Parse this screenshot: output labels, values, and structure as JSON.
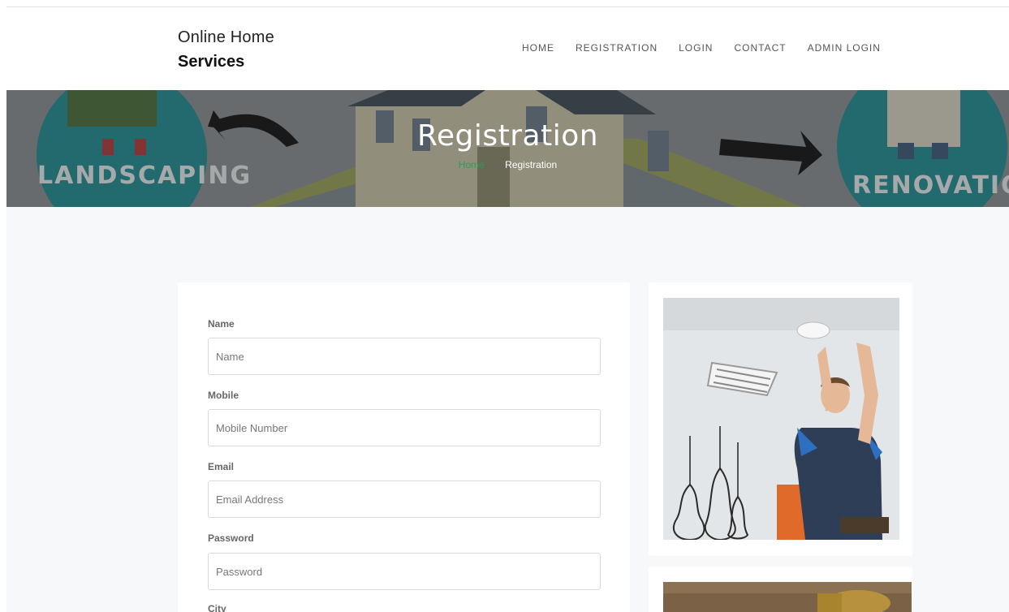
{
  "brand": {
    "line1": "Online Home",
    "line2": "Services"
  },
  "nav": {
    "items": [
      "HOME",
      "REGISTRATION",
      "LOGIN",
      "CONTACT",
      "ADMIN LOGIN"
    ]
  },
  "hero": {
    "title": "Registration",
    "breadcrumb": {
      "home": "Home",
      "current": "Registration"
    },
    "left_sign": "LANDSCAPING",
    "right_sign": "RENOVATION"
  },
  "form": {
    "fields": [
      {
        "label": "Name",
        "placeholder": "Name",
        "value": ""
      },
      {
        "label": "Mobile",
        "placeholder": "Mobile Number",
        "value": ""
      },
      {
        "label": "Email",
        "placeholder": "Email Address",
        "value": ""
      },
      {
        "label": "Password",
        "placeholder": "Password",
        "value": ""
      },
      {
        "label": "City",
        "placeholder": "",
        "value": ""
      }
    ]
  },
  "colors": {
    "accent": "#2e9b57",
    "page_bg": "#f6f8fa",
    "sign_teal": "#1f8e93"
  }
}
